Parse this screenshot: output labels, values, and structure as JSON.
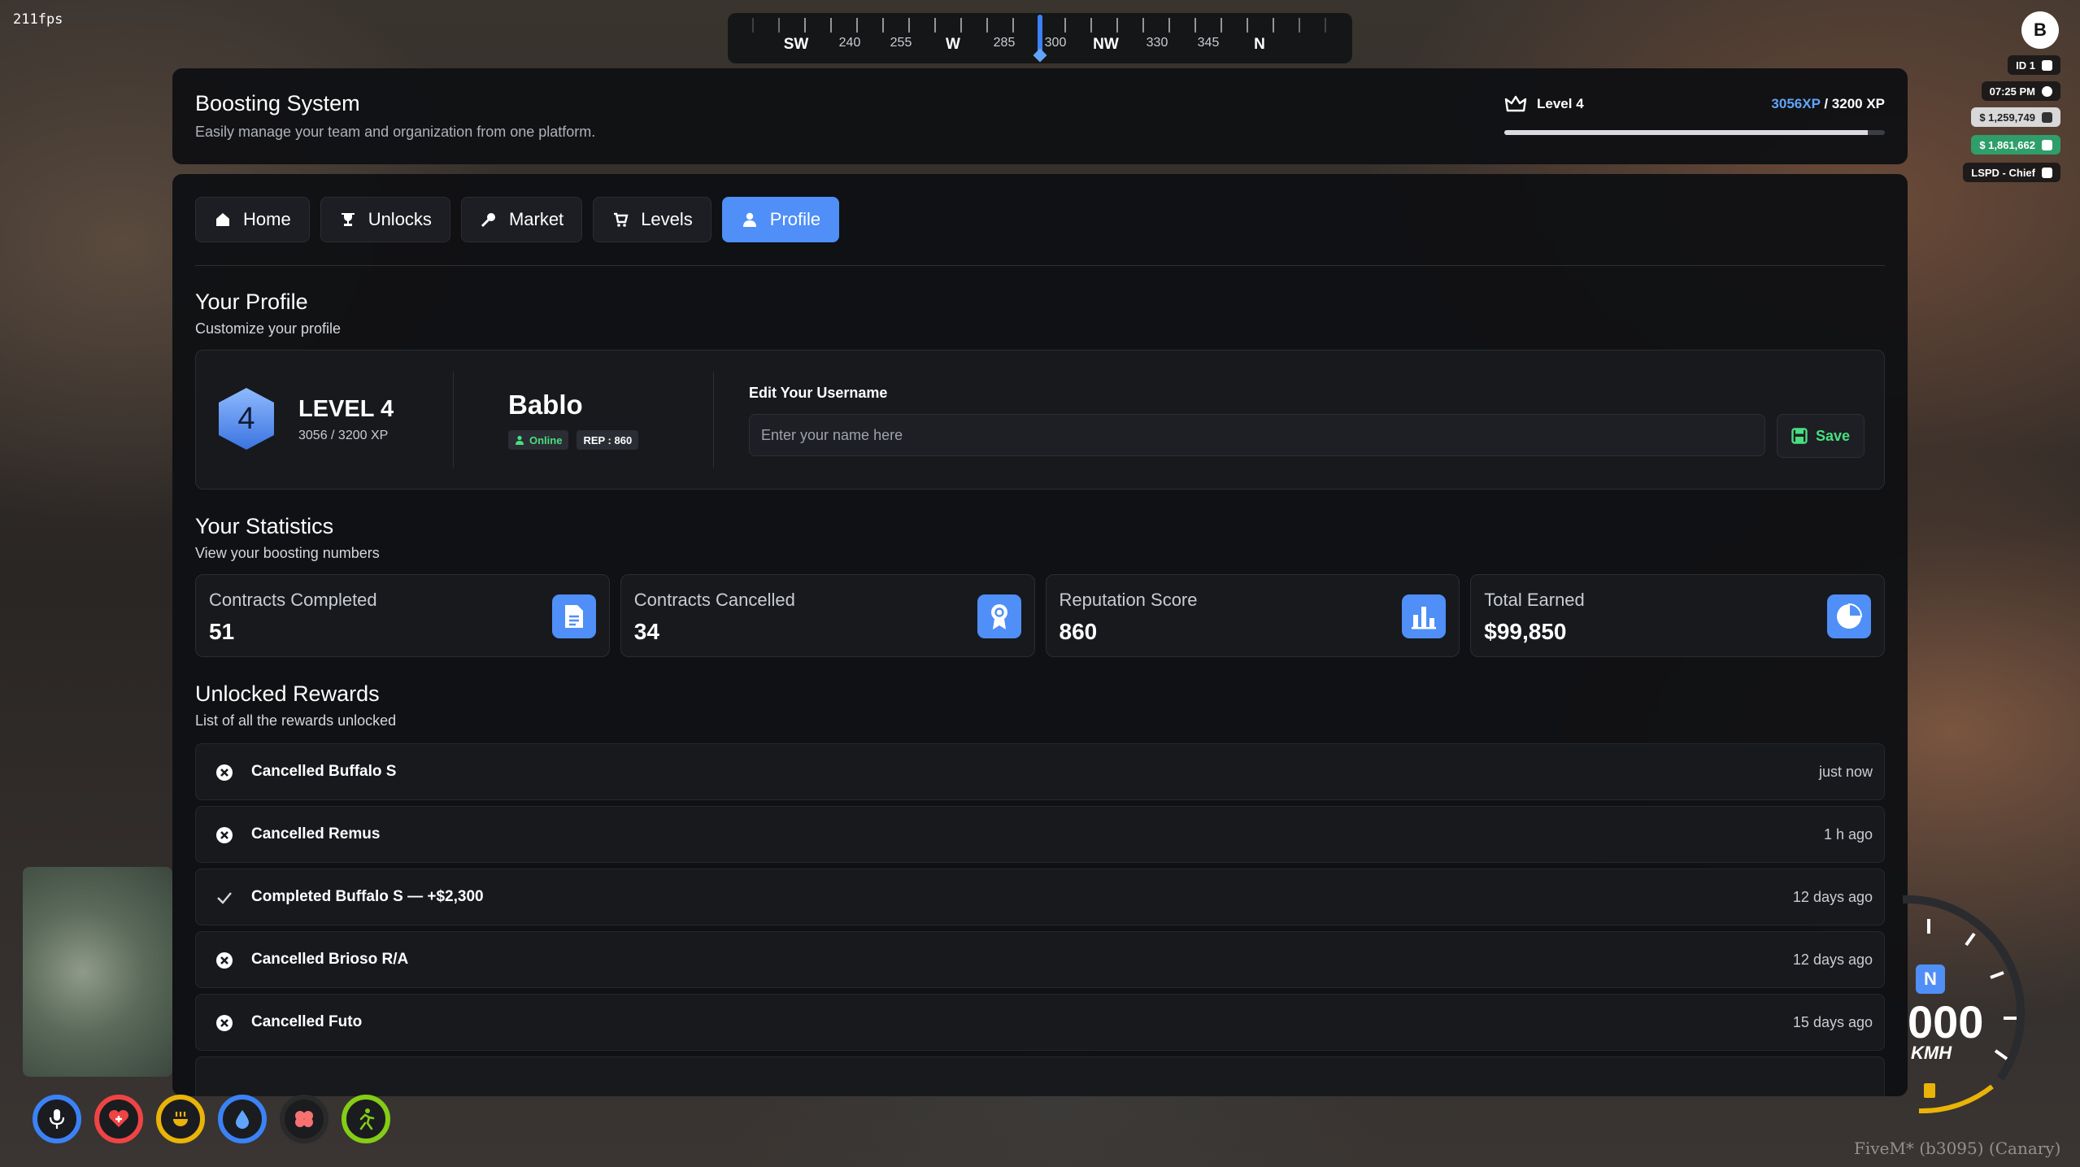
{
  "fps": "211fps",
  "compass": {
    "labels": [
      {
        "text": "SW",
        "cardinal": true
      },
      {
        "text": "240",
        "cardinal": false
      },
      {
        "text": "255",
        "cardinal": false
      },
      {
        "text": "W",
        "cardinal": true
      },
      {
        "text": "285",
        "cardinal": false
      },
      {
        "text": "300",
        "cardinal": false
      },
      {
        "text": "NW",
        "cardinal": true
      },
      {
        "text": "330",
        "cardinal": false
      },
      {
        "text": "345",
        "cardinal": false
      },
      {
        "text": "N",
        "cardinal": true
      }
    ]
  },
  "hud": {
    "logo": "B",
    "id": "ID 1",
    "time": "07:25 PM",
    "cash": "$ 1,259,749",
    "bank": "$ 1,861,662",
    "job": "LSPD - Chief"
  },
  "header": {
    "title": "Boosting System",
    "subtitle": "Easily manage your team and organization from one platform.",
    "level": "Level 4",
    "xp_current": "3056XP",
    "xp_total": " / 3200 XP",
    "xp_progress": 0.955
  },
  "tabs": [
    {
      "id": "home",
      "label": "Home",
      "icon": "home-icon"
    },
    {
      "id": "unlocks",
      "label": "Unlocks",
      "icon": "trophy-icon"
    },
    {
      "id": "market",
      "label": "Market",
      "icon": "key-icon"
    },
    {
      "id": "levels",
      "label": "Levels",
      "icon": "cart-icon"
    },
    {
      "id": "profile",
      "label": "Profile",
      "icon": "user-icon"
    }
  ],
  "active_tab": "profile",
  "profile": {
    "title": "Your Profile",
    "subtitle": "Customize your profile",
    "level_number": "4",
    "level_label": "LEVEL 4",
    "level_xp": "3056 / 3200 XP",
    "username": "Bablo",
    "status": "Online",
    "rep": "REP : 860",
    "edit_label": "Edit Your Username",
    "input_placeholder": "Enter your name here",
    "input_value": "",
    "save_label": "Save"
  },
  "statistics": {
    "title": "Your Statistics",
    "subtitle": "View your boosting numbers",
    "items": [
      {
        "label": "Contracts Completed",
        "value": "51",
        "icon": "document-icon"
      },
      {
        "label": "Contracts Cancelled",
        "value": "34",
        "icon": "award-icon"
      },
      {
        "label": "Reputation Score",
        "value": "860",
        "icon": "bar-chart-icon"
      },
      {
        "label": "Total Earned",
        "value": "$99,850",
        "icon": "pie-chart-icon"
      }
    ]
  },
  "rewards": {
    "title": "Unlocked Rewards",
    "subtitle": "List of all the rewards unlocked",
    "items": [
      {
        "text": "Cancelled Buffalo S",
        "time": "just now",
        "status": "cancelled"
      },
      {
        "text": "Cancelled Remus",
        "time": "1 h ago",
        "status": "cancelled"
      },
      {
        "text": "Completed Buffalo S — +$2,300",
        "time": "12 days ago",
        "status": "completed"
      },
      {
        "text": "Cancelled Brioso R/A",
        "time": "12 days ago",
        "status": "cancelled"
      },
      {
        "text": "Cancelled Futo",
        "time": "15 days ago",
        "status": "cancelled"
      }
    ]
  },
  "status_icons": [
    {
      "name": "voice-icon",
      "color": "#3b82f6"
    },
    {
      "name": "health-icon",
      "color": "#ef4444"
    },
    {
      "name": "hunger-icon",
      "color": "#eab308"
    },
    {
      "name": "thirst-icon",
      "color": "#3b82f6"
    },
    {
      "name": "stress-icon",
      "color": "#2a2a2a"
    },
    {
      "name": "stamina-icon",
      "color": "#84cc16"
    }
  ],
  "vehicle": {
    "gear": "N",
    "speed": "000",
    "unit": "KMH"
  },
  "watermark": "FiveM* (b3095) (Canary)",
  "colors": {
    "accent": "#4f8ff7",
    "success": "#4ade80",
    "panel": "#101114"
  }
}
